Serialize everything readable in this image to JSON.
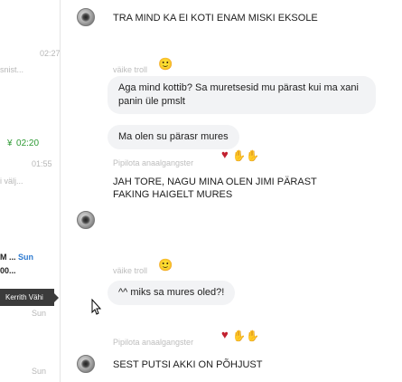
{
  "sidebar": {
    "row1": {
      "text": "",
      "sub": ""
    },
    "row2": {
      "time": "02:27",
      "sub": "snist..."
    },
    "row3": {
      "time": "02:20"
    },
    "row4": {
      "time": "01:55",
      "sub": "i välj..."
    },
    "row5": {
      "prefix": "M ...",
      "badge": "Sun",
      "sub": "00..."
    },
    "tooltip": "Kerrith Vähi",
    "row6": {
      "time": "Sun"
    },
    "row7": {
      "time": "Sun"
    }
  },
  "messages": [
    {
      "text": "TRA MIND KA EI KOTI ENAM MISKI EKSOLE"
    },
    {
      "sender": "väike troll",
      "text": "Aga mind kottib?  Sa muretsesid mu pärast kui ma xani panin üle pmslt"
    },
    {
      "text": "Ma olen su pärasr mures"
    },
    {
      "sender": "Pipilota anaalgangster",
      "text": "JAH TORE, NAGU MINA OLEN JIMI PÄRAST FAKING HAIGELT MURES"
    },
    {
      "sender": "väike troll",
      "text": "^^ miks sa mures oled?!"
    },
    {
      "sender": "Pipilota anaalgangster",
      "text": "SEST PUTSI AKKI ON PÕHJUST"
    }
  ],
  "icons": {
    "sticker": "face-sticker-icon",
    "heart": "heart-icon",
    "hands": "hands-icon",
    "avatar": "avatar-icon",
    "cursor": "cursor-icon"
  }
}
